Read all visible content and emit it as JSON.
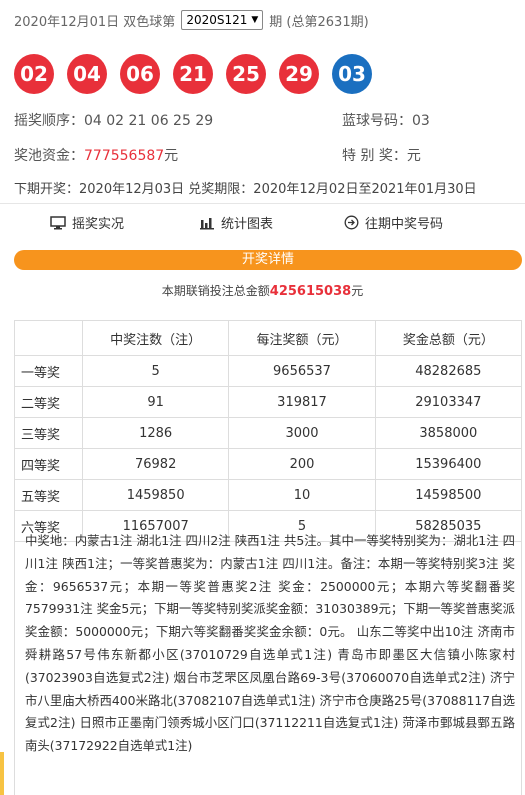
{
  "header": {
    "date_label": "2020年12月01日 双色球第",
    "issue_value": "2020S121",
    "issue_arrow": "▼",
    "period_label": "期 (总第2631期)"
  },
  "balls": {
    "red": [
      "02",
      "04",
      "06",
      "21",
      "25",
      "29"
    ],
    "blue": "03",
    "colors": {
      "red": "#e8303a",
      "blue": "#1a6fc0"
    }
  },
  "info": {
    "order": "摇奖顺序：04 02 21 06 25 29",
    "blue_number": "蓝球号码：03",
    "pool_label": "奖池资金：",
    "pool_value": "777556587",
    "pool_unit": "元",
    "special": "特 别 奖：元",
    "next_draw": "下期开奖：2020年12月03日 兑奖期限：2020年12月02日至2021年01月30日"
  },
  "nav": {
    "live_label": "摇奖实况",
    "chart_label": "统计图表",
    "history_label": "往期中奖号码"
  },
  "details_bar": "开奖详情",
  "sales": {
    "prefix": "本期联销投注总金额",
    "amount": "425615038",
    "unit": "元"
  },
  "table": {
    "headers": [
      "",
      "中奖注数（注）",
      "每注奖额（元）",
      "奖金总额（元）"
    ],
    "rows": [
      [
        "一等奖",
        "5",
        "9656537",
        "48282685"
      ],
      [
        "二等奖",
        "91",
        "319817",
        "29103347"
      ],
      [
        "三等奖",
        "1286",
        "3000",
        "3858000"
      ],
      [
        "四等奖",
        "76982",
        "200",
        "15396400"
      ],
      [
        "五等奖",
        "1459850",
        "10",
        "14598500"
      ],
      [
        "六等奖",
        "11657007",
        "5",
        "58285035"
      ]
    ]
  },
  "notes": "中奖地：内蒙古1注 湖北1注 四川2注 陕西1注 共5注。其中一等奖特别奖为：湖北1注 四川1注 陕西1注；一等奖普惠奖为：内蒙古1注 四川1注。备注：本期一等奖特别奖3注 奖金：9656537元；本期一等奖普惠奖2注 奖金：2500000元；本期六等奖翻番奖7579931注 奖金5元；下期一等奖特别奖派奖金额：31030389元；下期一等奖普惠奖派奖金额：5000000元；下期六等奖翻番奖奖金余额：0元。 山东二等奖中出10注 济南市舜耕路57号伟东新都小区(37010729自选单式1注) 青岛市即墨区大信镇小陈家村(37023903自选复式2注) 烟台市芝罘区凤凰台路69-3号(37060070自选单式2注) 济宁市八里庙大桥西400米路北(37082107自选单式1注) 济宁市仓庚路25号(37088117自选复式2注) 日照市正墨南门领秀城小区门口(37112211自选复式1注) 菏泽市鄄城县鄄五路南头(37172922自选单式1注)"
}
